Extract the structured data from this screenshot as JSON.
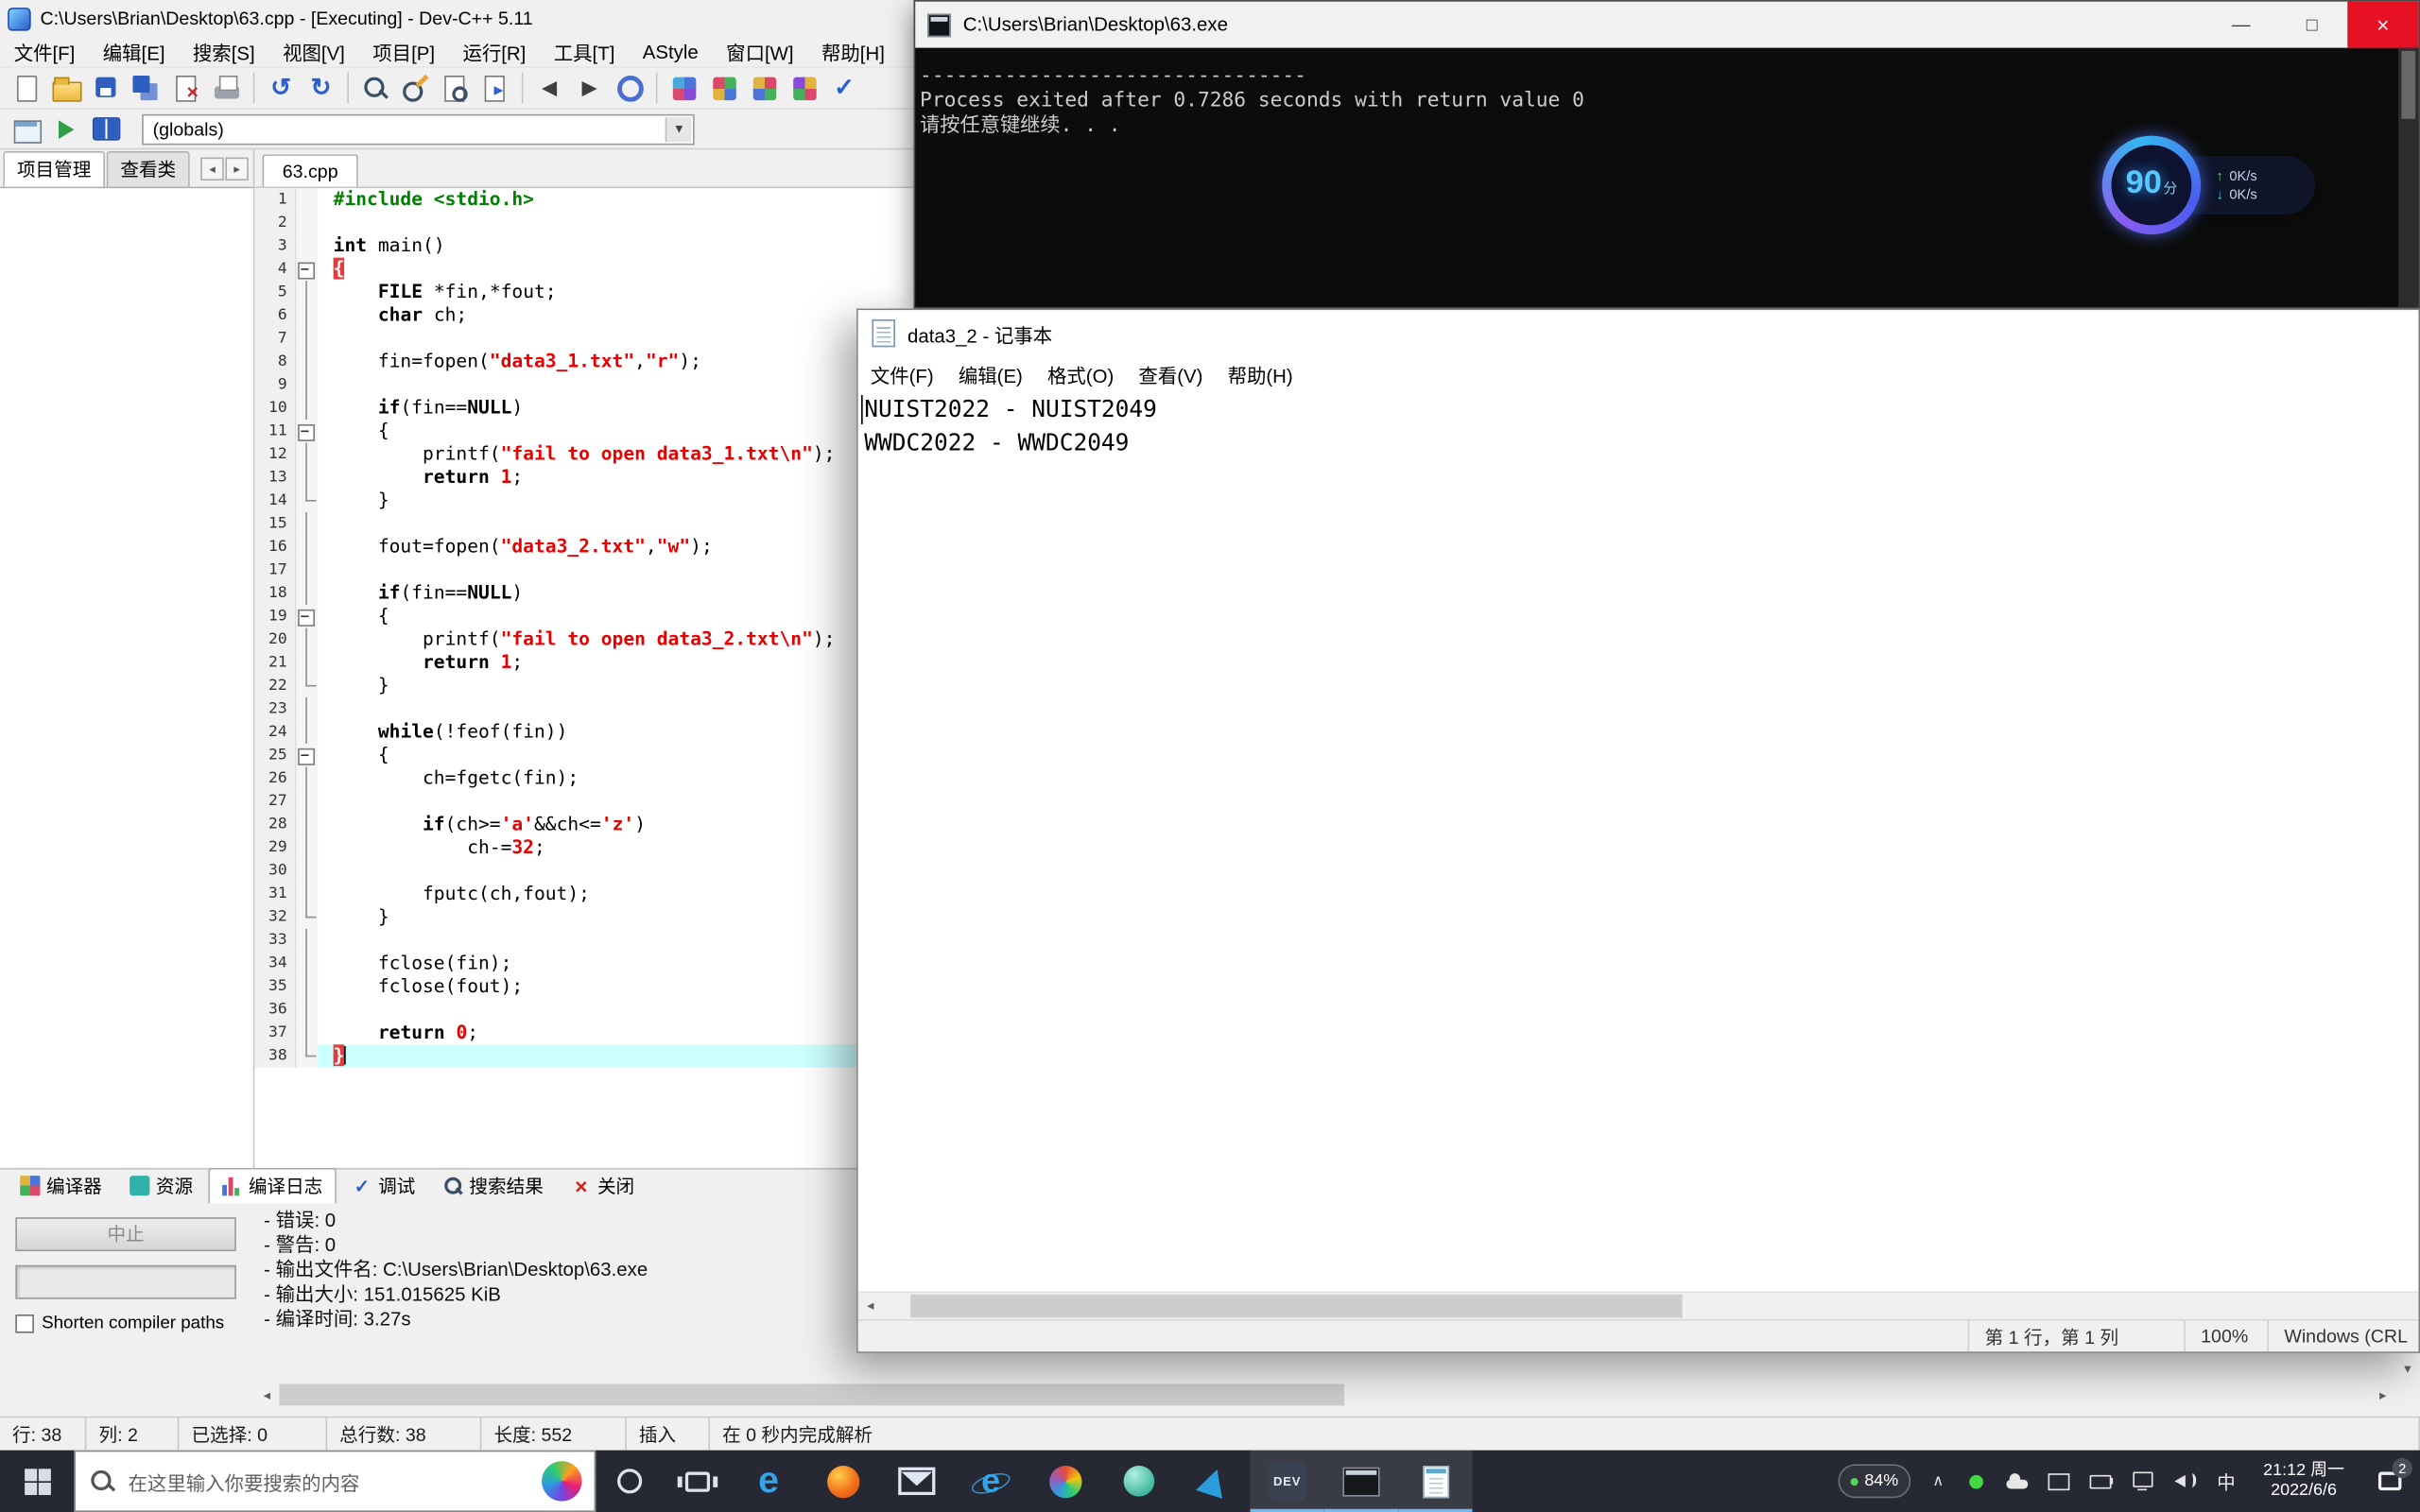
{
  "devcpp": {
    "title": "C:\\Users\\Brian\\Desktop\\63.cpp - [Executing] - Dev-C++ 5.11",
    "menu": [
      "文件[F]",
      "编辑[E]",
      "搜索[S]",
      "视图[V]",
      "项目[P]",
      "运行[R]",
      "工具[T]",
      "AStyle",
      "窗口[W]",
      "帮助[H]"
    ],
    "toolbar1": [
      {
        "n": "new-file-icon",
        "t": "page"
      },
      {
        "n": "open-file-icon",
        "t": "folder"
      },
      {
        "n": "save-icon",
        "t": "floppy"
      },
      {
        "n": "save-all-icon",
        "t": "floppy2"
      },
      {
        "n": "close-file-icon",
        "t": "pageclose"
      },
      {
        "n": "print-icon",
        "t": "printer"
      },
      {
        "t": "sep"
      },
      {
        "n": "undo-icon",
        "t": "undo"
      },
      {
        "n": "redo-icon",
        "t": "redo"
      },
      {
        "t": "sep"
      },
      {
        "n": "find-icon",
        "t": "magnifier"
      },
      {
        "n": "replace-icon",
        "t": "magpencil"
      },
      {
        "n": "find-in-files-icon",
        "t": "pagemag"
      },
      {
        "n": "goto-line-icon",
        "t": "pagearrow"
      },
      {
        "t": "sep"
      },
      {
        "n": "back-icon",
        "t": "back"
      },
      {
        "n": "forward-icon",
        "t": "forward"
      },
      {
        "n": "run-to-cursor-icon",
        "t": "ring"
      },
      {
        "t": "sep"
      },
      {
        "n": "compile-icon",
        "t": "grid1"
      },
      {
        "n": "run-icon",
        "t": "grid2"
      },
      {
        "n": "compile-run-icon",
        "t": "grid3"
      },
      {
        "n": "rebuild-all-icon",
        "t": "grid4"
      },
      {
        "n": "debug-icon",
        "t": "check"
      }
    ],
    "toolbar2_icons": [
      {
        "n": "open-project-icon",
        "t": "window"
      },
      {
        "n": "goto-definition-icon",
        "t": "greenarrow"
      },
      {
        "n": "class-browser-icon",
        "t": "book"
      }
    ],
    "globals_combo": "(globals)",
    "left_tabs": [
      "项目管理",
      "查看类"
    ],
    "editor_tab": "63.cpp",
    "code": {
      "current_line": 38,
      "fold": [
        "",
        "",
        "",
        "box",
        "line",
        "line",
        "line",
        "line",
        "line",
        "line",
        "box",
        "line",
        "line",
        "end",
        "line",
        "line",
        "line",
        "line",
        "box",
        "line",
        "line",
        "end",
        "line",
        "line",
        "box",
        "line",
        "line",
        "line",
        "line",
        "line",
        "line",
        "end",
        "line",
        "line",
        "line",
        "line",
        "line",
        "end"
      ],
      "lines": [
        [
          [
            "p",
            "#include <stdio.h>"
          ]
        ],
        [],
        [
          [
            "k",
            "int"
          ],
          [
            "t",
            " main()"
          ]
        ],
        [
          [
            "b",
            "{"
          ]
        ],
        [
          [
            "t",
            "    "
          ],
          [
            "k",
            "FILE"
          ],
          [
            "t",
            " *fin,*fout;"
          ]
        ],
        [
          [
            "t",
            "    "
          ],
          [
            "k",
            "char"
          ],
          [
            "t",
            " ch;"
          ]
        ],
        [],
        [
          [
            "t",
            "    fin=fopen("
          ],
          [
            "s",
            "\"data3_1.txt\""
          ],
          [
            "t",
            ","
          ],
          [
            "s",
            "\"r\""
          ],
          [
            "t",
            ");"
          ]
        ],
        [],
        [
          [
            "t",
            "    "
          ],
          [
            "k",
            "if"
          ],
          [
            "t",
            "(fin=="
          ],
          [
            "k",
            "NULL"
          ],
          [
            "t",
            ")"
          ]
        ],
        [
          [
            "t",
            "    {"
          ]
        ],
        [
          [
            "t",
            "        printf("
          ],
          [
            "s",
            "\"fail to open data3_1.txt\\n\""
          ],
          [
            "t",
            ");"
          ]
        ],
        [
          [
            "t",
            "        "
          ],
          [
            "k",
            "return"
          ],
          [
            "t",
            " "
          ],
          [
            "n",
            "1"
          ],
          [
            "t",
            ";"
          ]
        ],
        [
          [
            "t",
            "    }"
          ]
        ],
        [],
        [
          [
            "t",
            "    fout=fopen("
          ],
          [
            "s",
            "\"data3_2.txt\""
          ],
          [
            "t",
            ","
          ],
          [
            "s",
            "\"w\""
          ],
          [
            "t",
            ");"
          ]
        ],
        [],
        [
          [
            "t",
            "    "
          ],
          [
            "k",
            "if"
          ],
          [
            "t",
            "(fin=="
          ],
          [
            "k",
            "NULL"
          ],
          [
            "t",
            ")"
          ]
        ],
        [
          [
            "t",
            "    {"
          ]
        ],
        [
          [
            "t",
            "        printf("
          ],
          [
            "s",
            "\"fail to open data3_2.txt\\n\""
          ],
          [
            "t",
            ");"
          ]
        ],
        [
          [
            "t",
            "        "
          ],
          [
            "k",
            "return"
          ],
          [
            "t",
            " "
          ],
          [
            "n",
            "1"
          ],
          [
            "t",
            ";"
          ]
        ],
        [
          [
            "t",
            "    }"
          ]
        ],
        [],
        [
          [
            "t",
            "    "
          ],
          [
            "k",
            "while"
          ],
          [
            "t",
            "(!feof(fin))"
          ]
        ],
        [
          [
            "t",
            "    {"
          ]
        ],
        [
          [
            "t",
            "        ch=fgetc(fin);"
          ]
        ],
        [],
        [
          [
            "t",
            "        "
          ],
          [
            "k",
            "if"
          ],
          [
            "t",
            "(ch>="
          ],
          [
            "s",
            "'a'"
          ],
          [
            "t",
            "&&ch<="
          ],
          [
            "s",
            "'z'"
          ],
          [
            "t",
            ")"
          ]
        ],
        [
          [
            "t",
            "            ch-="
          ],
          [
            "n",
            "32"
          ],
          [
            "t",
            ";"
          ]
        ],
        [],
        [
          [
            "t",
            "        fputc(ch,fout);"
          ]
        ],
        [
          [
            "t",
            "    }"
          ]
        ],
        [],
        [
          [
            "t",
            "    fclose(fin);"
          ]
        ],
        [
          [
            "t",
            "    fclose(fout);"
          ]
        ],
        [],
        [
          [
            "t",
            "    "
          ],
          [
            "k",
            "return"
          ],
          [
            "t",
            " "
          ],
          [
            "n",
            "0"
          ],
          [
            "t",
            ";"
          ]
        ],
        [
          [
            "b",
            "}"
          ]
        ]
      ]
    },
    "bottom_tabs": [
      {
        "name": "tab-compiler",
        "icon": "grid",
        "label": "编译器"
      },
      {
        "name": "tab-resources",
        "icon": "res",
        "label": "资源"
      },
      {
        "name": "tab-compile-log",
        "icon": "chart",
        "label": "编译日志",
        "active": true
      },
      {
        "name": "tab-debug",
        "icon": "check",
        "label": "调试"
      },
      {
        "name": "tab-search-results",
        "icon": "mag",
        "label": "搜索结果"
      },
      {
        "name": "tab-close",
        "icon": "close",
        "label": "关闭"
      }
    ],
    "abort_label": "中止",
    "shorten_label": "Shorten compiler paths",
    "compile_log": [
      "- 错误: 0",
      "- 警告: 0",
      "- 输出文件名: C:\\Users\\Brian\\Desktop\\63.exe",
      "- 输出大小: 151.015625 KiB",
      "- 编译时间: 3.27s"
    ],
    "status": [
      "行: 38",
      "列: 2",
      "已选择: 0",
      "总行数: 38",
      "长度: 552",
      "插入",
      "在 0 秒内完成解析"
    ]
  },
  "console": {
    "title": "C:\\Users\\Brian\\Desktop\\63.exe",
    "lines": [
      "--------------------------------",
      "Process exited after 0.7286 seconds with return value 0",
      "请按任意键继续. . ."
    ]
  },
  "notepad": {
    "title": "data3_2 - 记事本",
    "menu": [
      "文件(F)",
      "编辑(E)",
      "格式(O)",
      "查看(V)",
      "帮助(H)"
    ],
    "content": [
      "NUIST2022 - NUIST2049",
      "WWDC2022 - WWDC2049"
    ],
    "status": {
      "line_col": "第 1 行，第 1 列",
      "zoom": "100%",
      "encoding": "Windows (CRL"
    }
  },
  "widget": {
    "score": "90",
    "unit": "分",
    "up_label": "0K/s",
    "down_label": "0K/s"
  },
  "taskbar": {
    "search_placeholder": "在这里输入你要搜索的内容",
    "apps": [
      {
        "name": "edge-icon",
        "t": "edge"
      },
      {
        "name": "orange-app-icon",
        "t": "orange"
      },
      {
        "name": "mail-icon",
        "t": "mail"
      },
      {
        "name": "ie-icon",
        "t": "ie"
      },
      {
        "name": "colorful-app-icon",
        "t": "colorful"
      },
      {
        "name": "teal-app-icon",
        "t": "teal"
      },
      {
        "name": "kite-app-icon",
        "t": "kite"
      },
      {
        "name": "devcpp-taskbar-icon",
        "t": "dev",
        "label": "DEV",
        "active": true
      },
      {
        "name": "console-taskbar-icon",
        "t": "console",
        "active": true
      },
      {
        "name": "notepad-taskbar-icon",
        "t": "notepad",
        "active": true
      }
    ],
    "battery": "84%",
    "tray": [
      {
        "name": "green-status-icon",
        "t": "green"
      },
      {
        "name": "cloud-icon",
        "t": "cloud"
      },
      {
        "name": "tray-mail-icon",
        "t": "mailS"
      },
      {
        "name": "tray-battery-icon",
        "t": "battS"
      },
      {
        "name": "network-icon",
        "t": "net"
      },
      {
        "name": "volume-icon",
        "t": "vol"
      },
      {
        "name": "ime-indicator",
        "t": "ime",
        "text": "中"
      }
    ],
    "time": "21:12 周一",
    "date": "2022/6/6",
    "badge": "2"
  }
}
